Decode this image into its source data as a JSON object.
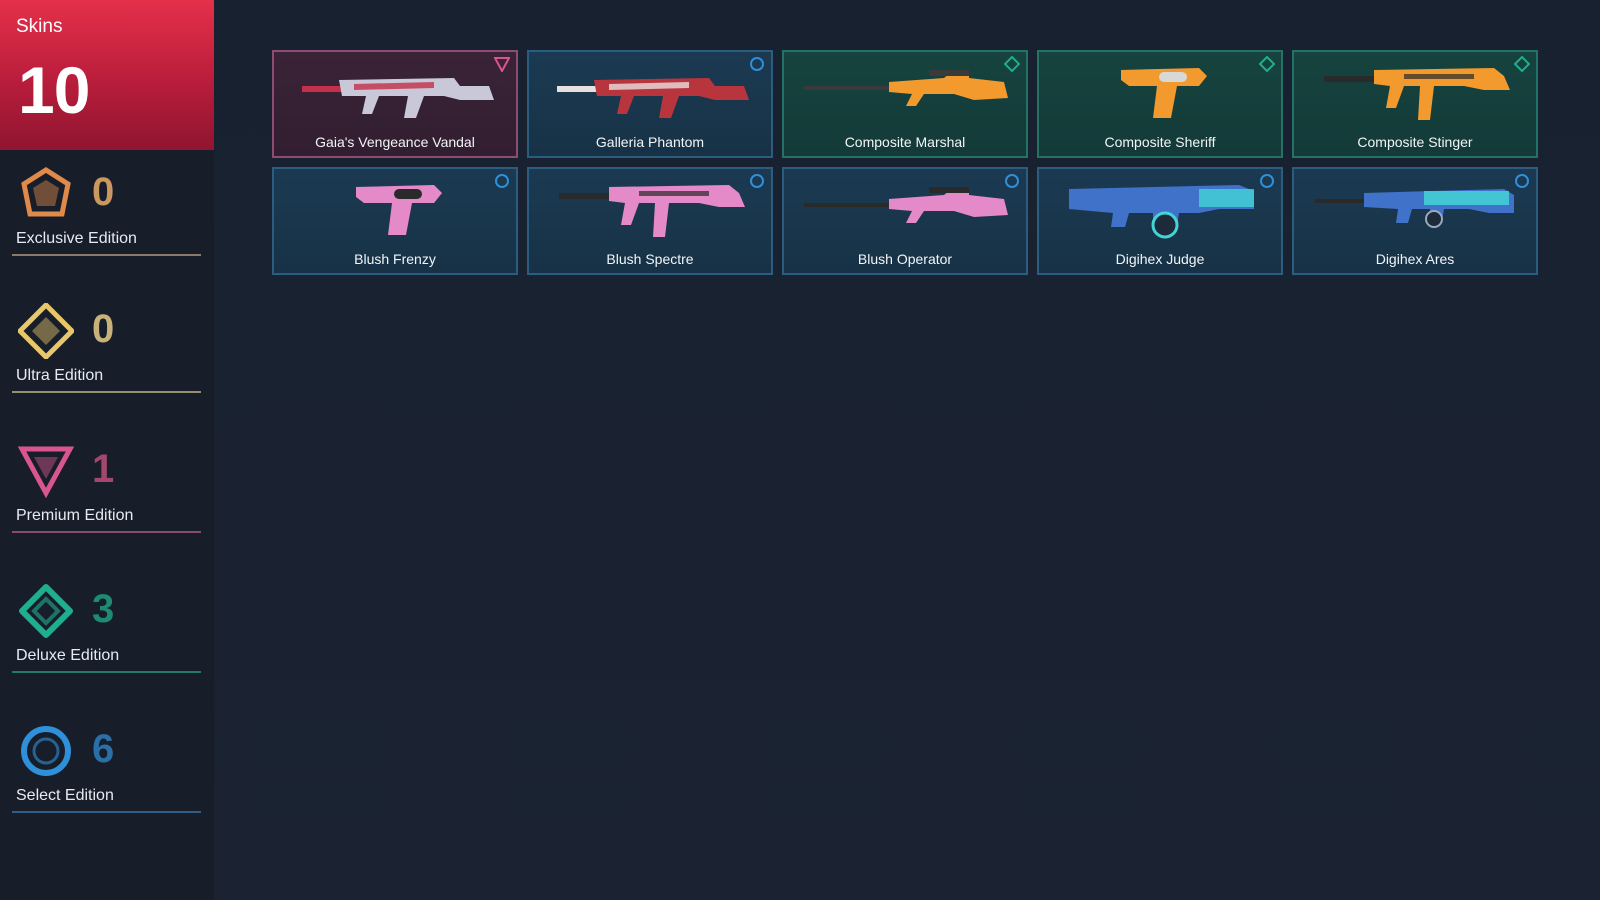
{
  "summary": {
    "label": "Skins",
    "total": "10"
  },
  "tiers": [
    {
      "name": "Exclusive Edition",
      "count": "0",
      "color": "#e08a4a",
      "icon": "exclusive-tier-icon"
    },
    {
      "name": "Ultra Edition",
      "count": "0",
      "color": "#e8c66a",
      "icon": "ultra-tier-icon"
    },
    {
      "name": "Premium Edition",
      "count": "1",
      "color": "#d9558f",
      "icon": "premium-tier-icon"
    },
    {
      "name": "Deluxe Edition",
      "count": "3",
      "color": "#1fae8f",
      "icon": "deluxe-tier-icon"
    },
    {
      "name": "Select Edition",
      "count": "6",
      "color": "#2f8fd8",
      "icon": "select-tier-icon"
    }
  ],
  "skins": [
    {
      "name": "Gaia's Vengeance Vandal",
      "tier": "premium",
      "weapon": "rifle",
      "colors": [
        "#c8c8d8",
        "#c2304a"
      ]
    },
    {
      "name": "Galleria Phantom",
      "tier": "select",
      "weapon": "rifle",
      "colors": [
        "#b8353e",
        "#e8e0e0"
      ]
    },
    {
      "name": "Composite Marshal",
      "tier": "deluxe",
      "weapon": "sniper",
      "colors": [
        "#f29a2e",
        "#3a3a3a"
      ]
    },
    {
      "name": "Composite Sheriff",
      "tier": "deluxe",
      "weapon": "pistol",
      "colors": [
        "#f29a2e",
        "#d8d8d8"
      ]
    },
    {
      "name": "Composite Stinger",
      "tier": "deluxe",
      "weapon": "smg",
      "colors": [
        "#f29a2e",
        "#2a2a2a"
      ]
    },
    {
      "name": "Blush Frenzy",
      "tier": "select",
      "weapon": "pistol",
      "colors": [
        "#e48ac8",
        "#2a2a2a"
      ]
    },
    {
      "name": "Blush Spectre",
      "tier": "select",
      "weapon": "smg",
      "colors": [
        "#e48ac8",
        "#2a2a2a"
      ]
    },
    {
      "name": "Blush Operator",
      "tier": "select",
      "weapon": "sniper",
      "colors": [
        "#e48ac8",
        "#2a2a2a"
      ]
    },
    {
      "name": "Digihex Judge",
      "tier": "select",
      "weapon": "shotgun",
      "colors": [
        "#3f72c8",
        "#44d4d8"
      ]
    },
    {
      "name": "Digihex Ares",
      "tier": "select",
      "weapon": "lmg",
      "colors": [
        "#3f72c8",
        "#44d4d8"
      ]
    }
  ]
}
